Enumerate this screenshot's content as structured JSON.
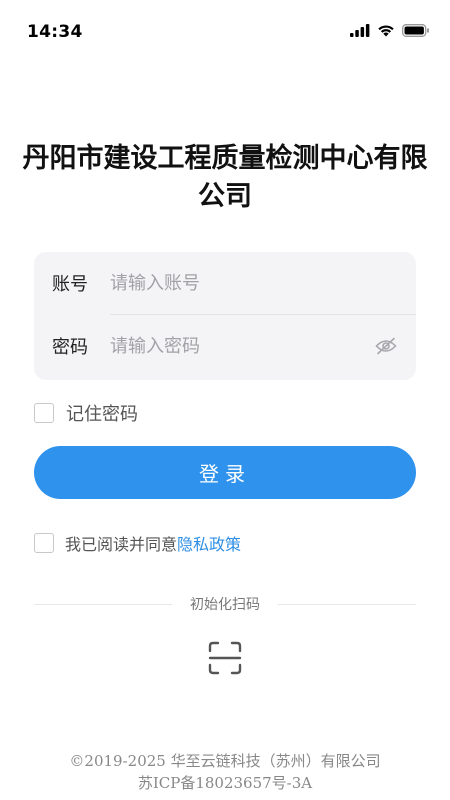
{
  "status_bar": {
    "time": "14:34",
    "icons": [
      "signal-icon",
      "wifi-icon",
      "battery-icon"
    ]
  },
  "title": "丹阳市建设工程质量检测中心有限公司",
  "form": {
    "account": {
      "label": "账号",
      "placeholder": "请输入账号",
      "value": ""
    },
    "password": {
      "label": "密码",
      "placeholder": "请输入密码",
      "value": "",
      "toggle_icon": "eye-hidden-icon"
    },
    "remember_label": "记住密码",
    "remember_checked": false
  },
  "login_button": "登录",
  "agreement": {
    "text": "我已阅读并同意",
    "link": "隐私政策",
    "checked": false
  },
  "init_scan": {
    "label": "初始化扫码",
    "icon": "scan-icon"
  },
  "footer": {
    "copyright": "©2019-2025 华至云链科技（苏州）有限公司",
    "icp": "苏ICP备18023657号-3A"
  },
  "colors": {
    "primary": "#2f93ee",
    "link": "#2f8fe4",
    "card_bg": "#f4f4f6"
  }
}
